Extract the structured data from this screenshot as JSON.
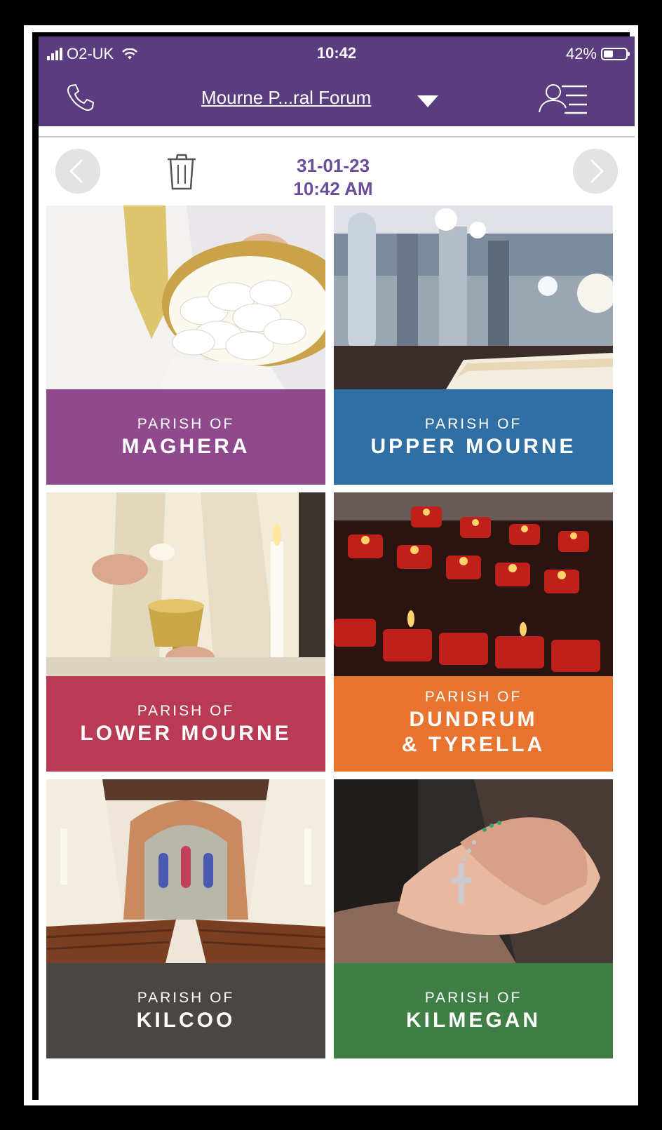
{
  "status_bar": {
    "carrier": "O2-UK",
    "time": "10:42",
    "battery": "42%",
    "battery_level": 0.42
  },
  "header": {
    "title": "Mourne P...ral Forum",
    "icons": [
      "phone-icon",
      "chevron-down-icon",
      "user-list-icon"
    ]
  },
  "date_bar": {
    "date": "31-01-23",
    "time": "10:42 AM",
    "icons": [
      "arrow-left-icon",
      "trash-icon",
      "arrow-right-icon"
    ]
  },
  "colors": {
    "header": "#5a3d7e",
    "date_text": "#6b4c9a",
    "maghera": "#8e4a8c",
    "upper_mourne": "#2f6fa3",
    "lower_mourne": "#b83a55",
    "dundrum": "#e8742f",
    "kilcoo": "#4a4644",
    "kilmegan": "#3f7f45"
  },
  "parishes": [
    {
      "prefix": "PARISH OF",
      "name": "MAGHERA",
      "name2": "",
      "color": "#8e4a8c"
    },
    {
      "prefix": "PARISH OF",
      "name": "UPPER MOURNE",
      "name2": "",
      "color": "#2f6fa3"
    },
    {
      "prefix": "PARISH OF",
      "name": "LOWER MOURNE",
      "name2": "",
      "color": "#b83a55"
    },
    {
      "prefix": "PARISH OF",
      "name": "DUNDRUM",
      "name2": "& TYRELLA",
      "color": "#e8742f"
    },
    {
      "prefix": "PARISH OF",
      "name": "KILCOO",
      "name2": "",
      "color": "#4a4644"
    },
    {
      "prefix": "PARISH OF",
      "name": "KILMEGAN",
      "name2": "",
      "color": "#3f7f45"
    }
  ]
}
